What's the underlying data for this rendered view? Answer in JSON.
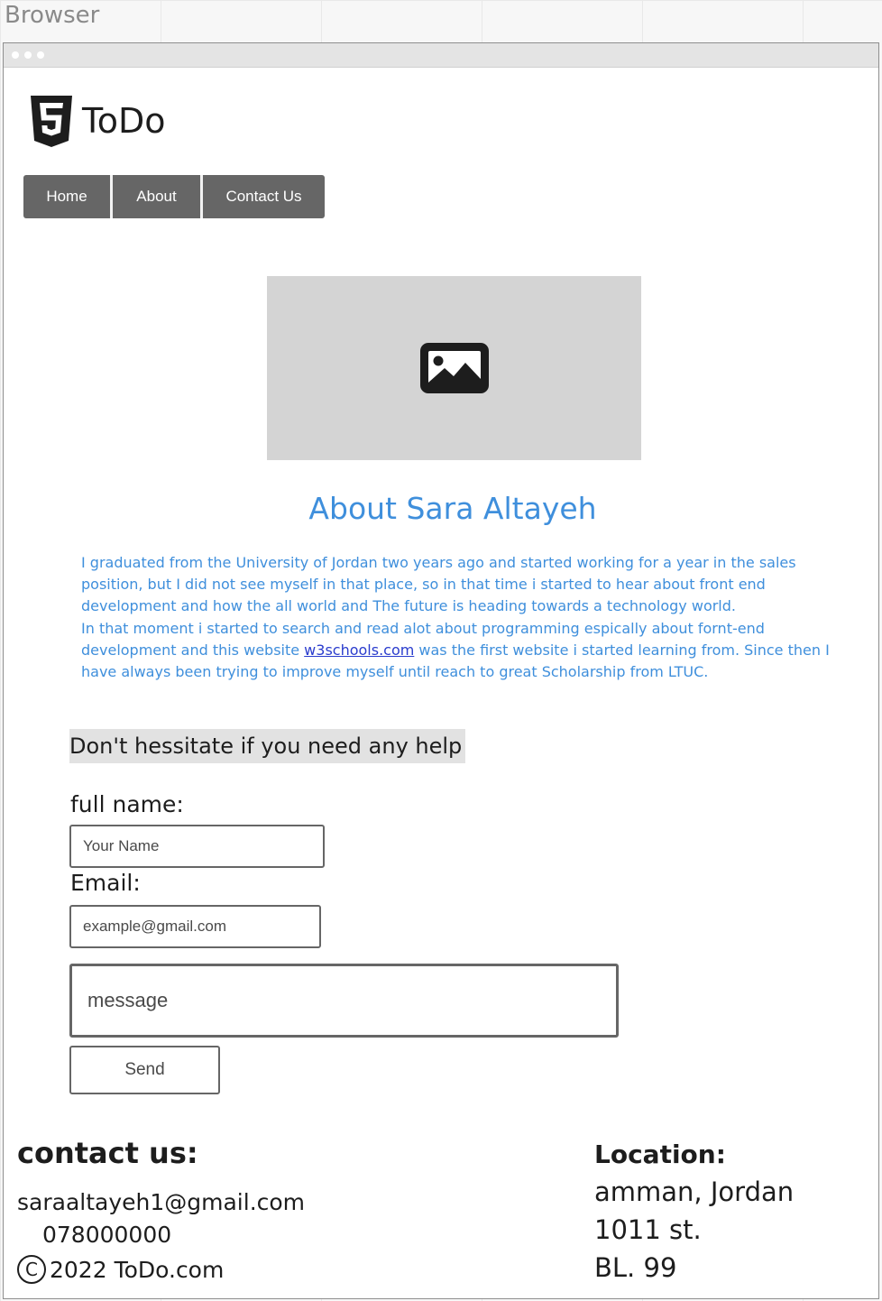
{
  "canvas": {
    "title": "Browser"
  },
  "header": {
    "logo_icon": "html5-icon",
    "brand": "ToDo"
  },
  "nav": {
    "items": [
      {
        "label": "Home"
      },
      {
        "label": "About"
      },
      {
        "label": "Contact Us"
      }
    ]
  },
  "hero": {
    "image_icon": "image-icon"
  },
  "about": {
    "title": "About Sara Altayeh",
    "paragraph1": "I graduated from the University of Jordan two years ago and started working for a year in the sales position, but I did not see myself in that place, so in that time i started to hear about front end development and how the all world and The future is heading towards a technology world.",
    "paragraph2_before": "In that moment i started to search and read alot about programming espically about fornt-end development and this website ",
    "link_text": "w3schools.com",
    "paragraph2_after": " was the first website i started learning from. Since then I have always been trying to improve myself until reach to great Scholarship from LTUC."
  },
  "contact_form": {
    "heading": "Don't hessitate if you need any help",
    "name_label": "full name:",
    "name_placeholder": "Your Name",
    "email_label": "Email:",
    "email_placeholder": "example@gmail.com",
    "message_placeholder": "message",
    "send_label": "Send"
  },
  "footer": {
    "contact_heading": "contact us:",
    "email": "saraaltayeh1@gmail.com",
    "phone": "078000000",
    "copyright_symbol": "©",
    "copyright_text": "2022 ToDo.com",
    "location_heading": "Location:",
    "location_lines": [
      "amman, Jordan",
      "1011 st.",
      "BL. 99"
    ]
  },
  "colors": {
    "accent": "#3f8fdc",
    "link": "#2a3ccd",
    "nav_bg": "#666666",
    "placeholder_bg": "#d4d4d4"
  }
}
